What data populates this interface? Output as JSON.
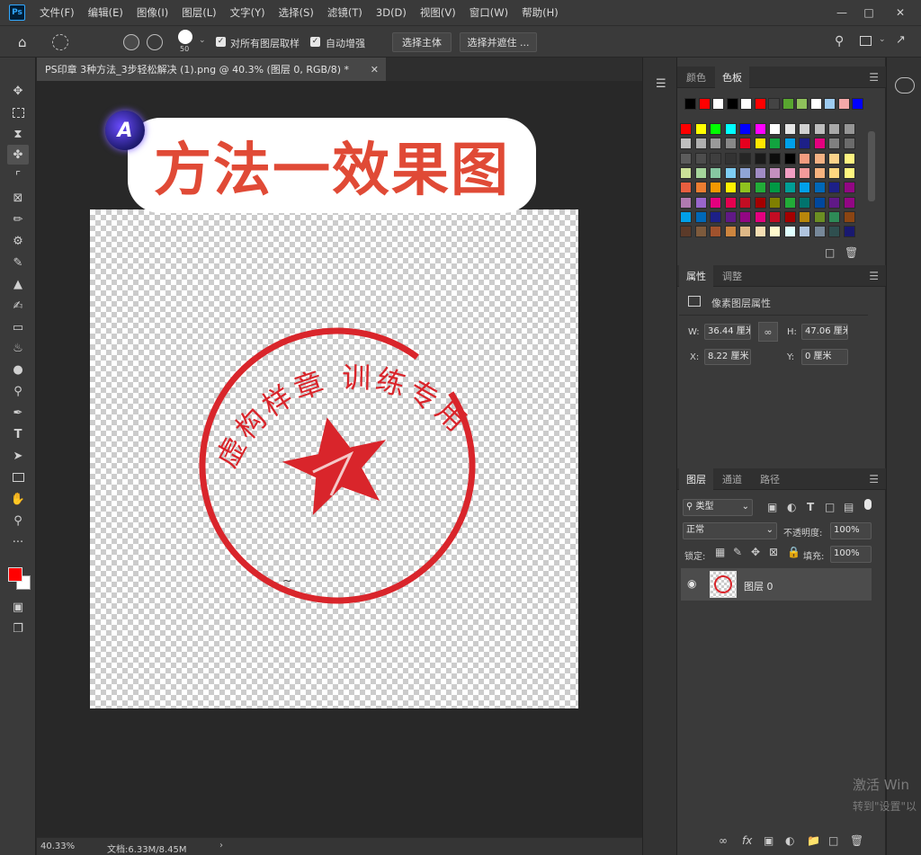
{
  "app": {
    "logo": "Ps"
  },
  "menu": [
    "文件(F)",
    "编辑(E)",
    "图像(I)",
    "图层(L)",
    "文字(Y)",
    "选择(S)",
    "滤镜(T)",
    "3D(D)",
    "视图(V)",
    "窗口(W)",
    "帮助(H)"
  ],
  "options": {
    "brush_size": "50",
    "sample_all_label": "对所有图层取样",
    "auto_enhance_label": "自动增强",
    "select_subject_label": "选择主体",
    "select_mask_label": "选择并遮住 ...",
    "sample_all_checked": true,
    "auto_enhance_checked": true
  },
  "document": {
    "tab_title": "PS印章  3种方法_3步轻松解决 (1).png @ 40.3% (图层 0, RGB/8) *",
    "overlay_title": "方法一效果图",
    "stamp_text_top": "虚构样章 训练专用"
  },
  "status": {
    "zoom": "40.33%",
    "doc_info": "文档:6.33M/8.45M"
  },
  "swatches_panel": {
    "tab_color": "颜色",
    "tab_swatches": "色板"
  },
  "properties_panel": {
    "tab_properties": "属性",
    "tab_adjust": "调整",
    "section_title": "像素图层属性",
    "w_label": "W:",
    "w_value": "36.44 厘米",
    "h_label": "H:",
    "h_value": "47.06 厘米",
    "x_label": "X:",
    "x_value": "8.22 厘米",
    "y_label": "Y:",
    "y_value": "0 厘米"
  },
  "layers_panel": {
    "tab_layers": "图层",
    "tab_channels": "通道",
    "tab_paths": "路径",
    "filter_label": "类型",
    "blend_mode": "正常",
    "opacity_label": "不透明度:",
    "opacity_value": "100%",
    "lock_label": "锁定:",
    "fill_label": "填充:",
    "fill_value": "100%",
    "layer_name": "图层 0"
  },
  "watermark": {
    "line1": "激活 Win",
    "line2": "转到\"设置\"以"
  },
  "colors": {
    "foreground": "#ff0000",
    "background": "#ffffff",
    "stamp_red": "#d9252b",
    "title_red": "#e04a36"
  }
}
